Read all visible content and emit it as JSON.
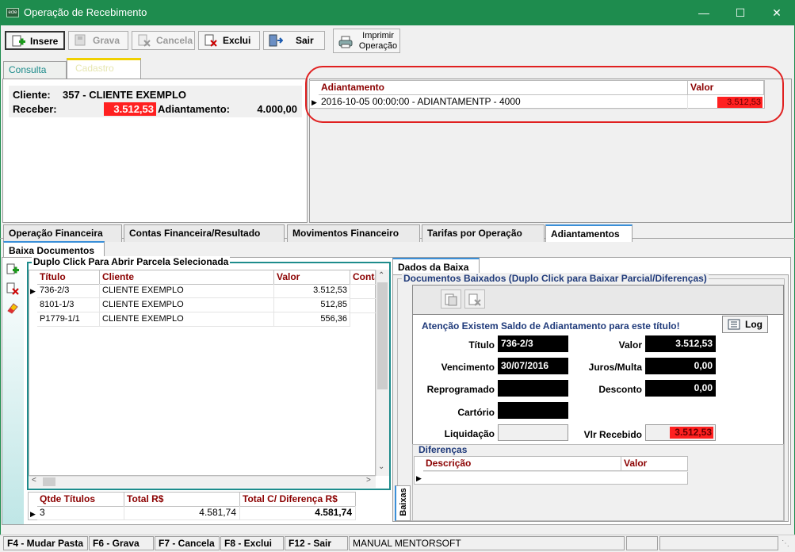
{
  "window": {
    "title": "Operação de Recebimento",
    "app_icon_text": "ecle"
  },
  "toolbar": {
    "insere": "Insere",
    "grava": "Grava",
    "cancela": "Cancela",
    "exclui": "Exclui",
    "sair": "Sair",
    "imprimir_l1": "Imprimir",
    "imprimir_l2": "Operação"
  },
  "top_tabs": {
    "consulta": "Consulta",
    "cadastro": "Cadastro"
  },
  "info": {
    "cliente_label": "Cliente:",
    "cliente_value": "357 - CLIENTE EXEMPLO",
    "receber_label": "Receber:",
    "receber_value": "3.512,53",
    "adiantamento_label": "Adiantamento:",
    "adiantamento_value": "4.000,00"
  },
  "adiant_grid": {
    "col_adiantamento": "Adiantamento",
    "col_valor": "Valor",
    "row_desc": "2016-10-05 00:00:00 - ADIANTAMENTP - 4000",
    "row_valor": "3.512,53"
  },
  "main_tabs": [
    "Operação Financeira",
    "Contas Financeira/Resultado",
    "Movimentos Financeiro",
    "Tarifas por Operação",
    "Adiantamentos"
  ],
  "sub_tab": "Baixa Documentos",
  "docs": {
    "group_title": "Duplo Click Para Abrir Parcela Selecionada",
    "cols": [
      "Título",
      "Cliente",
      "Valor",
      "Conta"
    ],
    "rows": [
      {
        "titulo": "736-2/3",
        "cliente": "CLIENTE EXEMPLO",
        "valor": "3.512,53"
      },
      {
        "titulo": "8101-1/3",
        "cliente": "CLIENTE EXEMPLO",
        "valor": "512,85"
      },
      {
        "titulo": "P1779-1/1",
        "cliente": "CLIENTE EXEMPLO",
        "valor": "556,36"
      }
    ]
  },
  "totals": {
    "qtde_label": "Qtde Títulos",
    "total_label": "Total R$",
    "total_dif_label": "Total C/ Diferença R$",
    "qtde": "3",
    "total": "4.581,74",
    "total_dif": "4.581,74"
  },
  "dados": {
    "tab": "Dados da Baixa",
    "group_title": "Documentos  Baixados (Duplo Click para Baixar Parcial/Diferenças)",
    "atencao": "Atenção Existem Saldo de Adiantamento para este título!",
    "log": "Log",
    "titulo_label": "Título",
    "titulo_value": "736-2/3",
    "valor_label": "Valor",
    "valor_value": "3.512,53",
    "venc_label": "Vencimento",
    "venc_value": "30/07/2016",
    "juros_label": "Juros/Multa",
    "juros_value": "0,00",
    "reprog_label": "Reprogramado",
    "desconto_label": "Desconto",
    "desconto_value": "0,00",
    "cartorio_label": "Cartório",
    "liquid_label": "Liquidação",
    "vlr_label": "Vlr Recebido",
    "vlr_value": "3.512,53",
    "dif_title": "Diferenças",
    "dif_col_desc": "Descrição",
    "dif_col_valor": "Valor",
    "side_tab": "Baixas"
  },
  "status": {
    "f4": "F4 - Mudar Pasta",
    "f6": "F6 - Grava",
    "f7": "F7 - Cancela",
    "f8": "F8 - Exclui",
    "f12": "F12 - Sair",
    "manual": "MANUAL MENTORSOFT"
  },
  "colors": {
    "title_bar": "#1e8c4e",
    "highlight_red": "#ff2020",
    "header_text": "#8b0000",
    "annotation": "#e02020"
  }
}
